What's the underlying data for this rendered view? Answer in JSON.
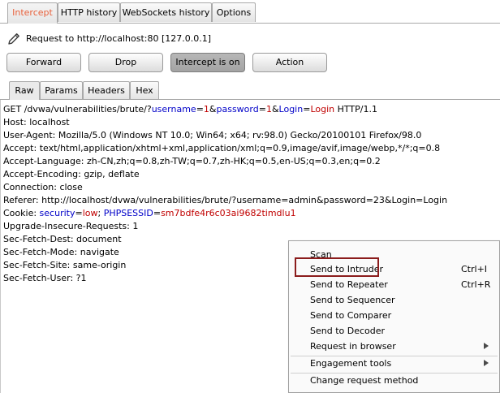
{
  "tabs": [
    {
      "label": "Intercept",
      "active": true
    },
    {
      "label": "HTTP history",
      "active": false
    },
    {
      "label": "WebSockets history",
      "active": false
    },
    {
      "label": "Options",
      "active": false
    }
  ],
  "request_info": {
    "label": "Request to http://localhost:80  [127.0.0.1]"
  },
  "buttons": {
    "forward": "Forward",
    "drop": "Drop",
    "intercept": "Intercept is on",
    "action": "Action"
  },
  "editor_tabs": [
    {
      "label": "Raw",
      "active": true
    },
    {
      "label": "Params",
      "active": false
    },
    {
      "label": "Headers",
      "active": false
    },
    {
      "label": "Hex",
      "active": false
    }
  ],
  "request": {
    "get_prefix": "GET /dvwa/vulnerabilities/brute/?",
    "p1_name": "username",
    "p1_eq": "=",
    "p1_val": "1",
    "amp1": "&",
    "p2_name": "password",
    "p2_eq": "=",
    "p2_val": "1",
    "amp2": "&",
    "p3_name": "Login",
    "p3_eq": "=",
    "p3_val": "Login",
    "get_suffix": " HTTP/1.1",
    "host": "Host: localhost",
    "user_agent": "User-Agent: Mozilla/5.0 (Windows NT 10.0; Win64; x64; rv:98.0) Gecko/20100101 Firefox/98.0",
    "accept": "Accept: text/html,application/xhtml+xml,application/xml;q=0.9,image/avif,image/webp,*/*;q=0.8",
    "accept_language": "Accept-Language: zh-CN,zh;q=0.8,zh-TW;q=0.7,zh-HK;q=0.5,en-US;q=0.3,en;q=0.2",
    "accept_encoding": "Accept-Encoding: gzip, deflate",
    "connection": "Connection: close",
    "referer": "Referer: http://localhost/dvwa/vulnerabilities/brute/?username=admin&password=23&Login=Login",
    "cookie_prefix": "Cookie: ",
    "c1_name": "security",
    "c1_eq": "=",
    "c1_val": "low",
    "c_sep": "; ",
    "c2_name": "PHPSESSID",
    "c2_eq": "=",
    "c2_val": "sm7bdfe4r6c03ai9682timdlu1",
    "upgrade": "Upgrade-Insecure-Requests: 1",
    "sec_dest": "Sec-Fetch-Dest: document",
    "sec_mode": "Sec-Fetch-Mode: navigate",
    "sec_site": "Sec-Fetch-Site: same-origin",
    "sec_user": "Sec-Fetch-User: ?1"
  },
  "context_menu": {
    "items": [
      {
        "label": "Scan",
        "shortcut": "",
        "submenu": false
      },
      {
        "label": "Send to Intruder",
        "shortcut": "Ctrl+I",
        "submenu": false
      },
      {
        "label": "Send to Repeater",
        "shortcut": "Ctrl+R",
        "submenu": false
      },
      {
        "label": "Send to Sequencer",
        "shortcut": "",
        "submenu": false
      },
      {
        "label": "Send to Comparer",
        "shortcut": "",
        "submenu": false
      },
      {
        "label": "Send to Decoder",
        "shortcut": "",
        "submenu": false
      },
      {
        "label": "Request in browser",
        "shortcut": "",
        "submenu": true
      },
      {
        "label": "Engagement tools",
        "shortcut": "",
        "submenu": true
      },
      {
        "label": "Change request method",
        "shortcut": "",
        "submenu": false
      }
    ]
  },
  "colors": {
    "active_tab_text": "#e8613c",
    "param_name": "#0000c8",
    "param_value": "#c00000",
    "highlight_border": "#8b1c1c"
  },
  "icons": {
    "edit": "pencil-icon",
    "submenu": "chevron-right-icon"
  }
}
